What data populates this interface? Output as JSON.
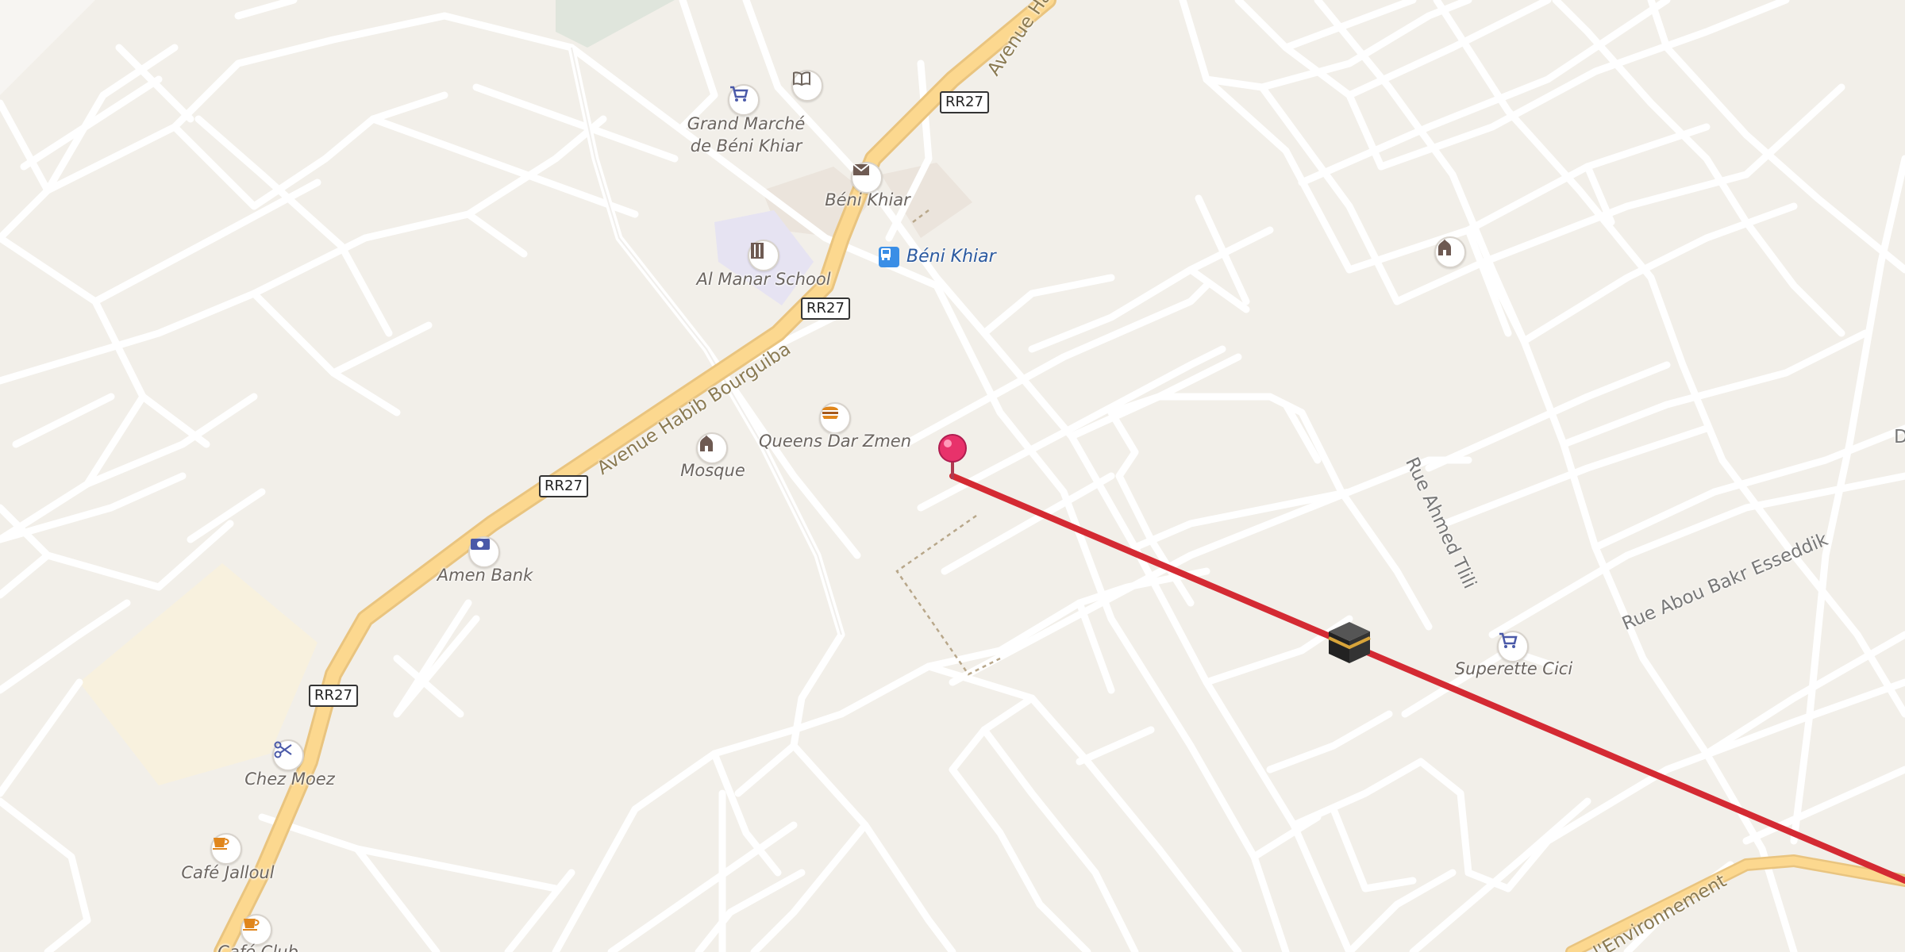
{
  "map": {
    "route_color": "#d42a33",
    "road_primary_color": "#fcd88f",
    "road_minor_color": "#ffffff",
    "background_color": "#f2efe9"
  },
  "streets": {
    "avenue_habib_bourguiba": "Avenue Habib Bourguiba",
    "avenue_ha": "Avenue Ha",
    "rue_ahmed_tlili": "Rue Ahmed Tlili",
    "rue_abou_bakr": "Rue Abou Bakr Esseddik",
    "environnement": "l'Environnement",
    "edge_d": "D"
  },
  "shields": {
    "rr27": "RR27"
  },
  "pois": {
    "grand_marche_line1": "Grand Marché",
    "grand_marche_line2": "de Béni Khiar",
    "post_beni_khiar": "Béni Khiar",
    "bus_beni_khiar": "Béni Khiar",
    "al_manar_school": "Al Manar School",
    "queens_dar_zmen": "Queens Dar Zmen",
    "mosque": "Mosque",
    "amen_bank": "Amen Bank",
    "superette_cici": "Superette Cici",
    "chez_moez": "Chez Moez",
    "cafe_jalloul": "Café Jalloul",
    "cafe_club": "Café Club"
  },
  "icons": {
    "shop": "shopping-cart-icon",
    "library": "book-icon",
    "post": "envelope-icon",
    "school": "school-icon",
    "bus": "bus-icon",
    "fastfood": "burger-icon",
    "mosque": "mosque-icon",
    "bank": "banknote-icon",
    "barber": "scissors-icon",
    "cafe": "coffee-cup-icon",
    "kaaba": "kaaba-icon",
    "pin": "location-pin-icon"
  }
}
